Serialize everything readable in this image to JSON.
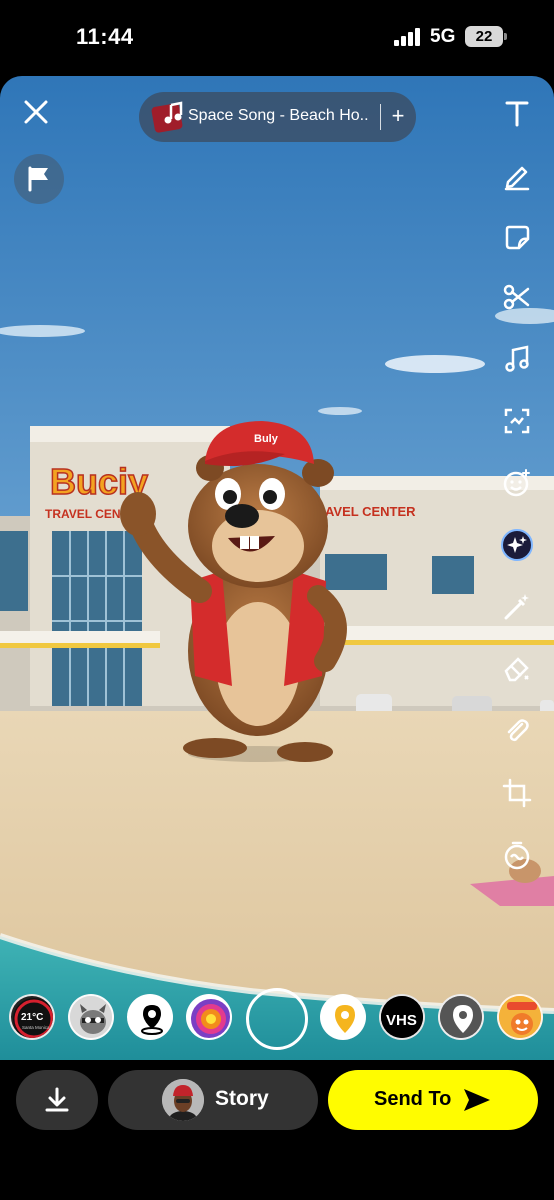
{
  "status_bar": {
    "time": "11:44",
    "network": "5G",
    "battery": "22"
  },
  "editor": {
    "music": {
      "title": "Space Song - Beach Ho...",
      "add": "+"
    },
    "tools": [
      "text-tool",
      "draw-tool",
      "sticker-tool",
      "scissors-tool",
      "music-tool",
      "scan-tool",
      "emoji-lens-tool",
      "ai-sparkle-tool",
      "magic-eraser-tool",
      "eraser-tool",
      "link-tool",
      "crop-tool",
      "timer-tool"
    ],
    "scene": {
      "store_sign": "Buciy",
      "store_subtitle_left": "TRAVEL CENTER",
      "store_subtitle_right": "AVEL CENTER",
      "cap_text": "Buly"
    },
    "lenses": {
      "weather_temp": "21°C",
      "weather_place": "Santa Monica",
      "vhs": "VHS"
    }
  },
  "bottom_bar": {
    "story_label": "Story",
    "send_to_label": "Send To"
  },
  "colors": {
    "send_to": "#fffc00",
    "sky_top": "#3f86c6",
    "sand": "#e6d3b0",
    "ocean": "#2fa3a8"
  }
}
